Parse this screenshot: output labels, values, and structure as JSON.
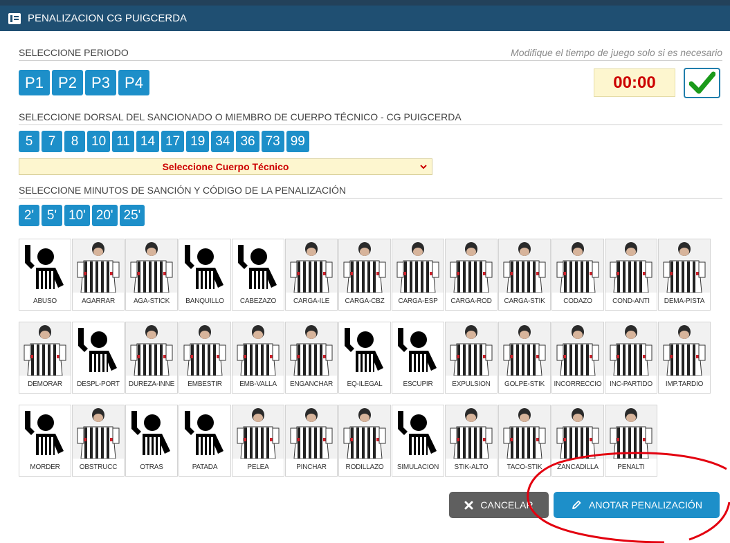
{
  "window": {
    "title": "PENALIZACION CG PUIGCERDA"
  },
  "period": {
    "label": "SELECCIONE PERIODO",
    "hint": "Modifique el tiempo de juego solo si es necesario",
    "buttons": [
      "P1",
      "P2",
      "P3",
      "P4"
    ],
    "clock": "00:00"
  },
  "dorsal": {
    "label": "SELECCIONE DORSAL DEL SANCIONADO O MIEMBRO DE CUERPO TÉCNICO - CG PUIGCERDA",
    "numbers": [
      "5",
      "7",
      "8",
      "10",
      "11",
      "14",
      "17",
      "19",
      "34",
      "36",
      "73",
      "99"
    ],
    "staff_select": "Seleccione Cuerpo Técnico"
  },
  "penalty": {
    "label": "SELECCIONE MINUTOS DE SANCIÓN Y CÓDIGO DE LA PENALIZACIÓN",
    "minutes": [
      "2'",
      "5'",
      "10'",
      "20'",
      "25'"
    ],
    "codes": [
      [
        {
          "name": "ABUSO",
          "icon": "generic-referee-icon"
        },
        {
          "name": "AGARRAR",
          "icon": "referee-photo"
        },
        {
          "name": "AGA-STICK",
          "icon": "referee-photo"
        },
        {
          "name": "BANQUILLO",
          "icon": "generic-referee-icon"
        },
        {
          "name": "CABEZAZO",
          "icon": "generic-referee-icon"
        },
        {
          "name": "CARGA-ILE",
          "icon": "referee-photo"
        },
        {
          "name": "CARGA-CBZ",
          "icon": "referee-photo"
        },
        {
          "name": "CARGA-ESP",
          "icon": "referee-photo"
        },
        {
          "name": "CARGA-ROD",
          "icon": "referee-photo"
        },
        {
          "name": "CARGA-STIK",
          "icon": "referee-photo"
        },
        {
          "name": "CODAZO",
          "icon": "referee-photo"
        },
        {
          "name": "COND-ANTI",
          "icon": "referee-photo"
        },
        {
          "name": "DEMA-PISTA",
          "icon": "referee-photo"
        }
      ],
      [
        {
          "name": "DEMORAR",
          "icon": "referee-photo"
        },
        {
          "name": "DESPL-PORT",
          "icon": "generic-referee-icon"
        },
        {
          "name": "DUREZA-INNE",
          "icon": "referee-photo"
        },
        {
          "name": "EMBESTIR",
          "icon": "referee-photo"
        },
        {
          "name": "EMB-VALLA",
          "icon": "referee-photo"
        },
        {
          "name": "ENGANCHAR",
          "icon": "referee-photo"
        },
        {
          "name": "EQ-ILEGAL",
          "icon": "generic-referee-icon"
        },
        {
          "name": "ESCUPIR",
          "icon": "generic-referee-icon"
        },
        {
          "name": "EXPULSION",
          "icon": "referee-photo"
        },
        {
          "name": "GOLPE-STIK",
          "icon": "referee-photo"
        },
        {
          "name": "INCORRECCIO",
          "icon": "referee-photo"
        },
        {
          "name": "INC-PARTIDO",
          "icon": "referee-photo"
        },
        {
          "name": "IMP.TARDIO",
          "icon": "referee-photo"
        }
      ],
      [
        {
          "name": "MORDER",
          "icon": "generic-referee-icon"
        },
        {
          "name": "OBSTRUCC",
          "icon": "referee-photo"
        },
        {
          "name": "OTRAS",
          "icon": "generic-referee-icon"
        },
        {
          "name": "PATADA",
          "icon": "generic-referee-icon"
        },
        {
          "name": "PELEA",
          "icon": "referee-photo"
        },
        {
          "name": "PINCHAR",
          "icon": "referee-photo"
        },
        {
          "name": "RODILLAZO",
          "icon": "referee-photo"
        },
        {
          "name": "SIMULACION",
          "icon": "generic-referee-icon"
        },
        {
          "name": "STIK-ALTO",
          "icon": "referee-photo"
        },
        {
          "name": "TACO-STIK",
          "icon": "referee-photo"
        },
        {
          "name": "ZANCADILLA",
          "icon": "referee-photo"
        },
        {
          "name": "PENALTI",
          "icon": "referee-photo"
        }
      ]
    ]
  },
  "actions": {
    "cancel": "CANCELAR",
    "submit": "ANOTAR PENALIZACIÓN"
  },
  "colors": {
    "primary": "#1d8fc9",
    "titlebar": "#1f4f72",
    "highlight": "#fdf6cf",
    "alert": "#cc0000",
    "annotation": "#e3000f"
  }
}
